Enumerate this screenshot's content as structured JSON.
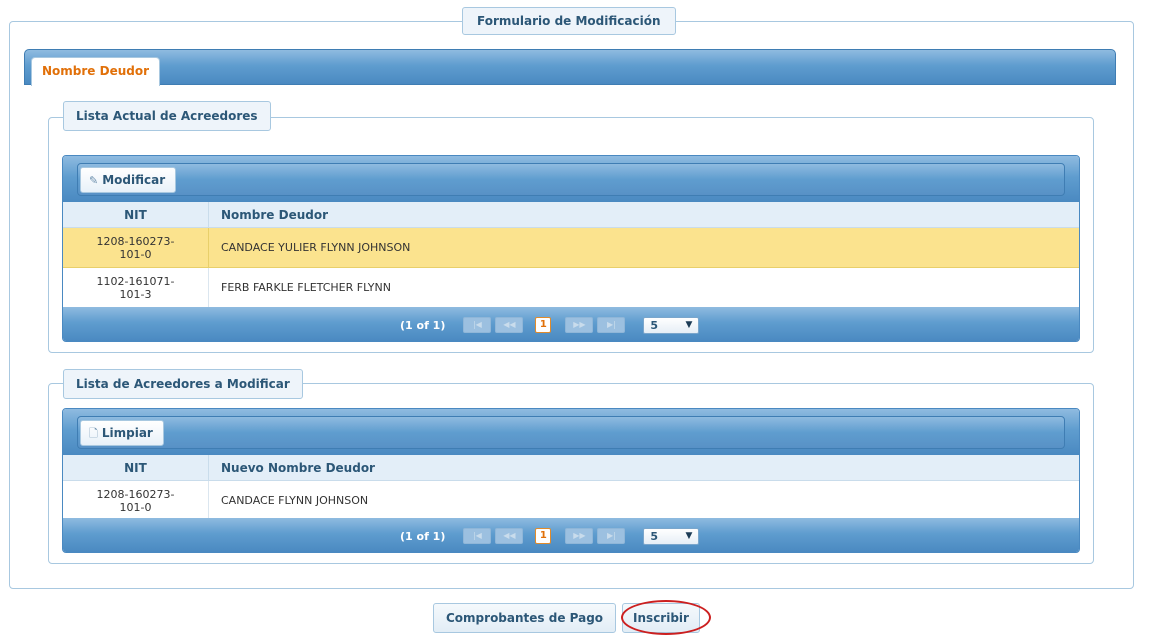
{
  "form": {
    "title": "Formulario de Modificación"
  },
  "tab": {
    "label": "Nombre Deudor"
  },
  "section_current": {
    "legend": "Lista Actual de Acreedores",
    "toolbar_button": "Modificar",
    "toolbar_icon": "pencil-icon",
    "columns": [
      "NIT",
      "Nombre Deudor"
    ],
    "rows": [
      {
        "nit_line1": "1208-160273-",
        "nit_line2": "101-0",
        "name": "CANDACE YULIER FLYNN JOHNSON",
        "selected": true
      },
      {
        "nit_line1": "1102-161071-",
        "nit_line2": "101-3",
        "name": "FERB FARKLE FLETCHER FLYNN",
        "selected": false
      }
    ],
    "paginator": {
      "summary": "(1 of 1)",
      "current_page": "1",
      "rows_per_page": "5"
    }
  },
  "section_modify": {
    "legend": "Lista de Acreedores a Modificar",
    "toolbar_button": "Limpiar",
    "toolbar_icon": "document-icon",
    "columns": [
      "NIT",
      "Nuevo Nombre Deudor"
    ],
    "rows": [
      {
        "nit_line1": "1208-160273-",
        "nit_line2": "101-0",
        "name": "CANDACE FLYNN JOHNSON",
        "selected": false
      }
    ],
    "paginator": {
      "summary": "(1 of 1)",
      "current_page": "1",
      "rows_per_page": "5"
    }
  },
  "actions": {
    "comprobantes_label": "Comprobantes de Pago",
    "inscribir_label": "Inscribir"
  },
  "colors": {
    "header_blue": "#4a89c1",
    "tab_orange": "#e17009",
    "selected_row": "#fbe38e",
    "highlight_circle": "#cc1f1f"
  }
}
